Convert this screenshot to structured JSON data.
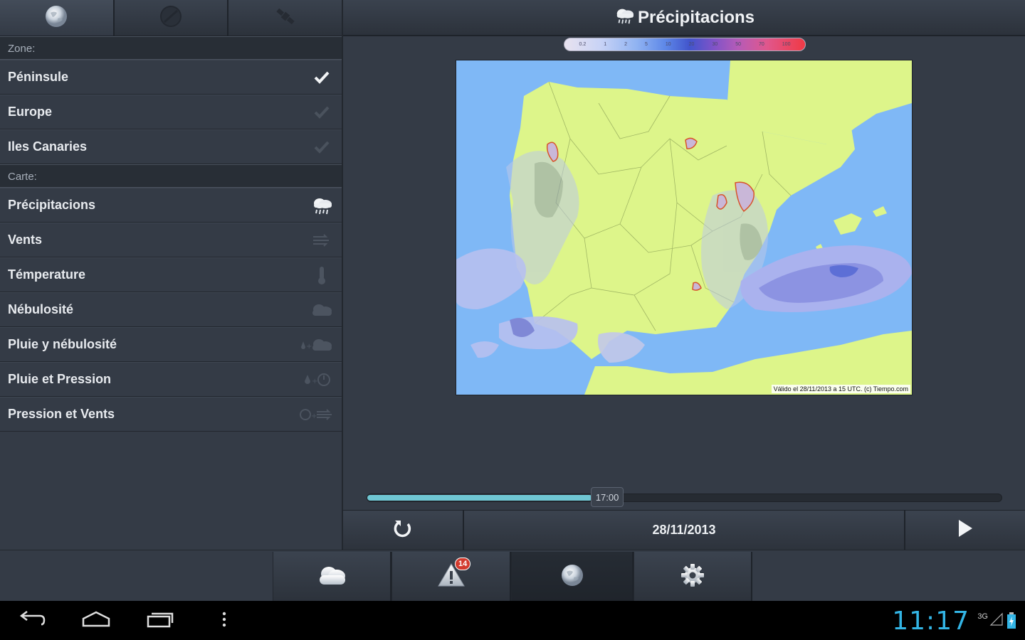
{
  "left_panel": {
    "zone_header": "Zone:",
    "zones": [
      {
        "label": "Péninsule",
        "selected": true
      },
      {
        "label": "Europe",
        "selected": false
      },
      {
        "label": "Iles Canaries",
        "selected": false
      }
    ],
    "map_header": "Carte:",
    "maps": [
      {
        "label": "Précipitacions",
        "icon": "rain-cloud-icon"
      },
      {
        "label": "Vents",
        "icon": "wind-icon"
      },
      {
        "label": "Témperature",
        "icon": "thermometer-icon"
      },
      {
        "label": "Nébulosité",
        "icon": "cloud-icon"
      },
      {
        "label": "Pluie y nébulosité",
        "icon": "rain-cloud-combo-icon"
      },
      {
        "label": "Pluie et Pression",
        "icon": "rain-pressure-icon"
      },
      {
        "label": "Pression et Vents",
        "icon": "pressure-wind-icon"
      }
    ]
  },
  "header": {
    "title": "Précipitacions"
  },
  "legend": {
    "ticks": [
      "0.2",
      "1",
      "2",
      "5",
      "10",
      "20",
      "30",
      "50",
      "70",
      "100"
    ]
  },
  "map": {
    "caption": "Válido el 28/11/2013 a 15 UTC. (c) Tiempo.com"
  },
  "timeline": {
    "time_label": "17:00",
    "progress": 0.354
  },
  "controls": {
    "date": "28/11/2013"
  },
  "bottom_nav": {
    "items": [
      "forecast-cloud-icon",
      "warning-icon",
      "globe-icon",
      "settings-gear-icon"
    ],
    "warning_badge": "14"
  },
  "status": {
    "clock": "11:17",
    "network": "3G"
  },
  "colors": {
    "accent": "#33b5e5",
    "progress": "#6fc6d3",
    "land": "#ddf58a",
    "sea": "#7fb8f6"
  }
}
